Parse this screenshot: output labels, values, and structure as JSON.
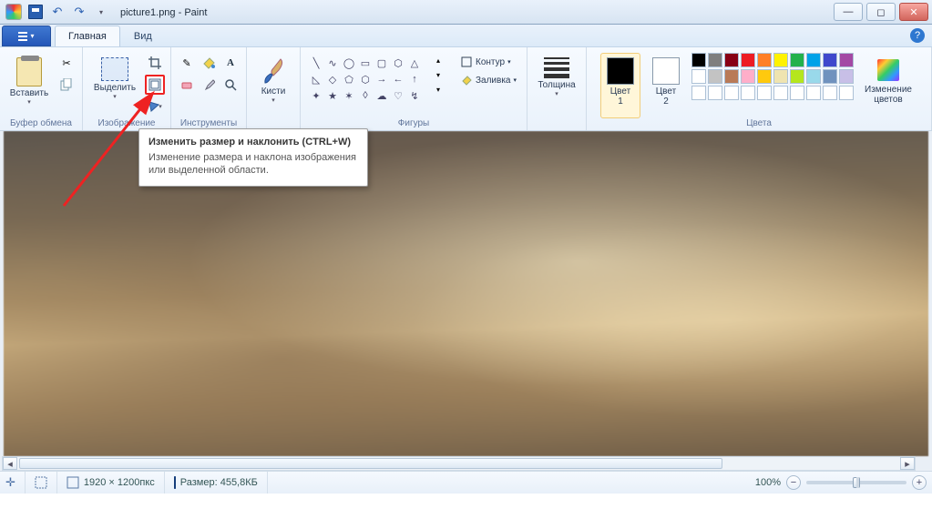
{
  "titlebar": {
    "filename": "picture1.png",
    "appname": "Paint",
    "separator": " - "
  },
  "tabs": {
    "file_caret": "▾",
    "home": "Главная",
    "view": "Вид"
  },
  "ribbon": {
    "clipboard": {
      "paste": "Вставить",
      "label": "Буфер обмена"
    },
    "image": {
      "select": "Выделить",
      "label": "Изображение"
    },
    "tools": {
      "label": "Инструменты"
    },
    "brushes": {
      "btn": "Кисти"
    },
    "shapes": {
      "outline": "Контур",
      "fill": "Заливка",
      "label": "Фигуры"
    },
    "size": {
      "btn": "Толщина"
    },
    "colors": {
      "c1": "Цвет\n1",
      "c2": "Цвет\n2",
      "edit": "Изменение\nцветов",
      "label": "Цвета",
      "active1": "#000000",
      "active2": "#ffffff",
      "palette": [
        "#000000",
        "#7f7f7f",
        "#880015",
        "#ed1c24",
        "#ff7f27",
        "#fff200",
        "#22b14c",
        "#00a2e8",
        "#3f48cc",
        "#a349a4",
        "#ffffff",
        "#c3c3c3",
        "#b97a57",
        "#ffaec9",
        "#ffc90e",
        "#efe4b0",
        "#b5e61d",
        "#99d9ea",
        "#7092be",
        "#c8bfe7",
        "#ffffff",
        "#ffffff",
        "#ffffff",
        "#ffffff",
        "#ffffff",
        "#ffffff",
        "#ffffff",
        "#ffffff",
        "#ffffff",
        "#ffffff"
      ]
    }
  },
  "tooltip": {
    "title": "Изменить размер и наклонить (CTRL+W)",
    "body": "Изменение размера и наклона изображения или выделенной области."
  },
  "statusbar": {
    "dims": "1920 × 1200пкс",
    "size_lbl": "Размер: ",
    "size_val": "455,8КБ",
    "zoom": "100%"
  }
}
